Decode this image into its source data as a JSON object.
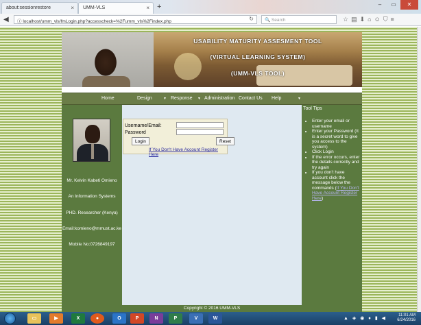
{
  "browser": {
    "tabs": [
      {
        "label": "about:sessionrestore"
      },
      {
        "label": "UMM-VLS"
      }
    ],
    "url": "localhost/umm_vls/fmLogin.php?accesscheck=%2Fumm_vls%2Findex.php",
    "search_placeholder": "Search"
  },
  "banner": {
    "line1": "USABILITY MATURITY ASSESMENT TOOL",
    "line2": "(VIRTUAL LEARNING SYSTEM)",
    "line3": "(UMM-VLS TOOL)"
  },
  "menu": {
    "home": "Home",
    "design": "Design",
    "response": "Response",
    "administration": "Administration",
    "contact": "Contact Us",
    "help": "Help"
  },
  "profile": {
    "name": "Mr. Kelvin Kabeti Omieno",
    "role1": "An Information Systems",
    "role2": "PHD. Researcher (Kenya)",
    "email": "Email:komieno@mmust.ac.ke",
    "mobile": "Mobile No:0726849197"
  },
  "login": {
    "username_label": "Username/Email:",
    "password_label": "Password",
    "username_value": "",
    "password_value": "",
    "login_button": "Login",
    "reset_button": "Reset",
    "register_link": "If You Don't Have Account Register Here"
  },
  "tooltips": {
    "title": "Tool Tips",
    "items": [
      "Enter your email or username",
      "Enter your Password (It is a secret word to give you access to the system)",
      "Click Login",
      "If the error occurs, enter the details correctly and try again",
      "If you don't have account click the message below the commands ("
    ],
    "link_text": "If You Don't Have Account Register Here",
    "link_suffix": ")"
  },
  "footer": {
    "copyright": "Copyright © 2016 UMM-VLS"
  },
  "taskbar": {
    "time": "11:01 AM",
    "date": "6/24/2016"
  }
}
